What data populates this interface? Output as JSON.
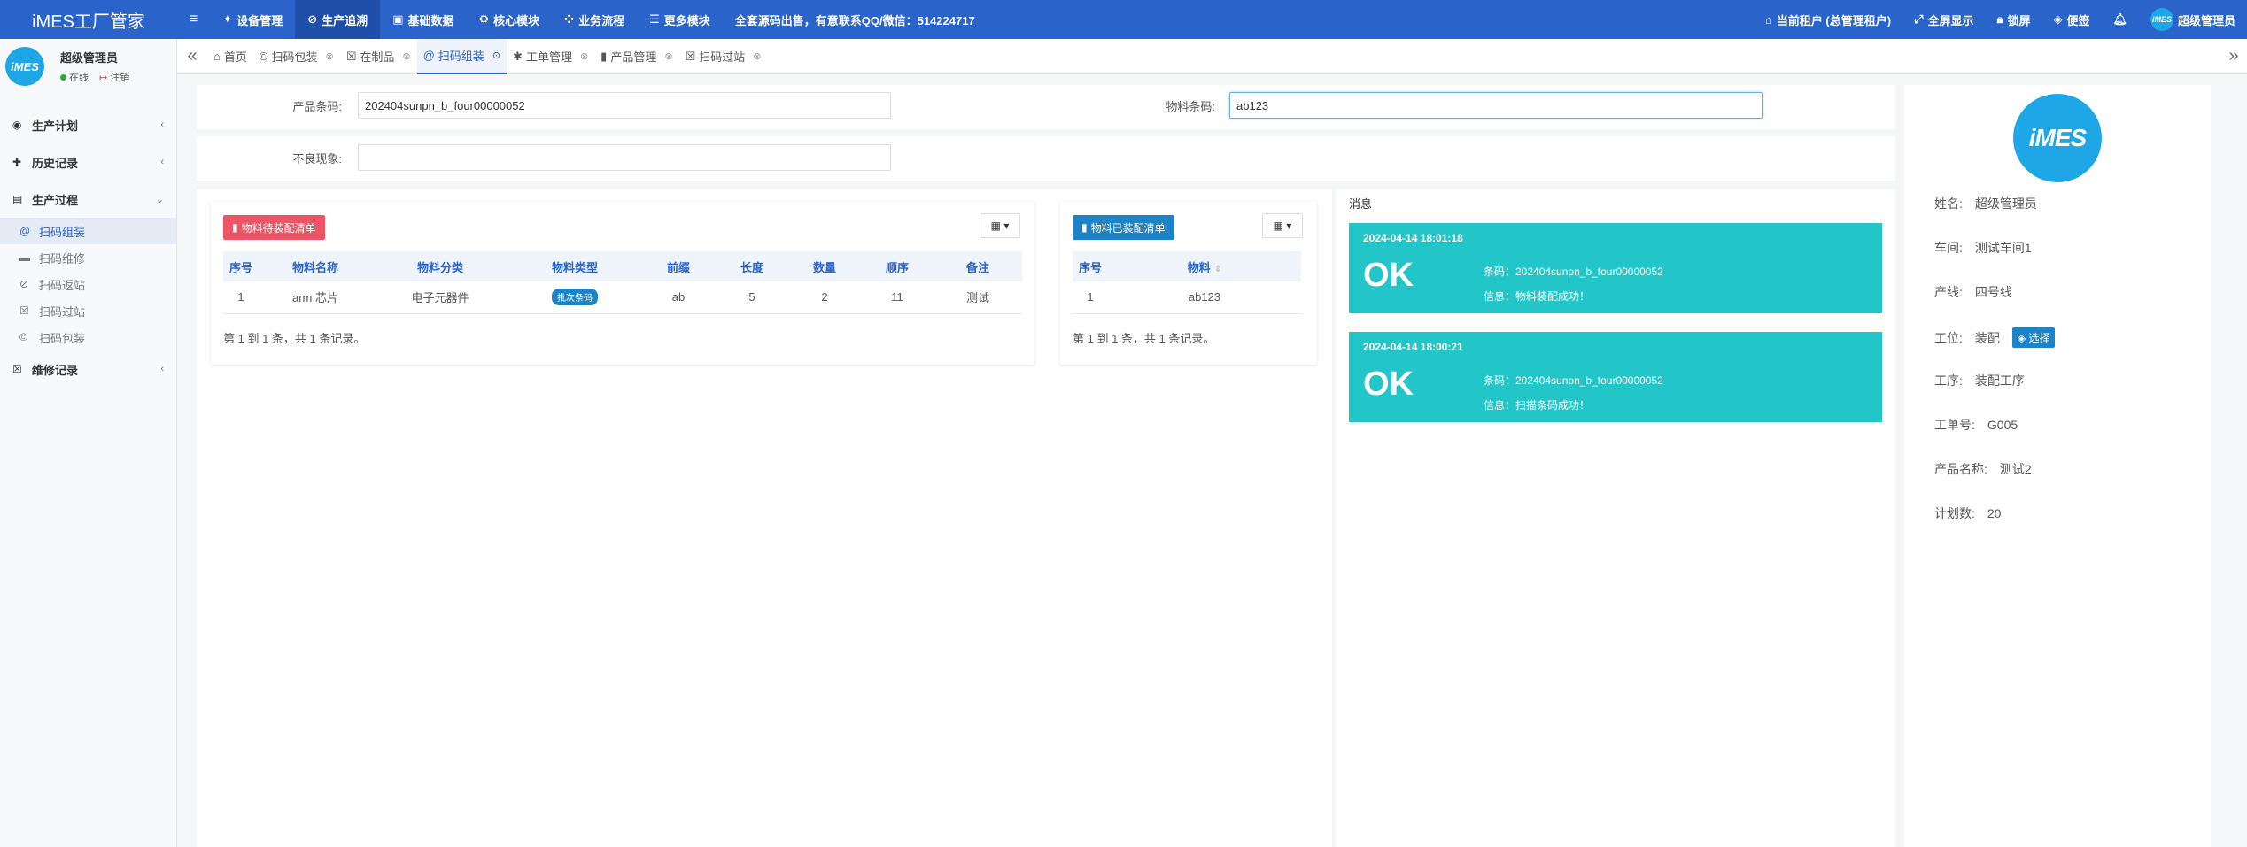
{
  "app": {
    "title": "iMES工厂管家"
  },
  "topnav": {
    "menu_icon": "≡",
    "items": [
      {
        "label": "设备管理",
        "icon": "tool-icon"
      },
      {
        "label": "生产追溯",
        "icon": "link-icon"
      },
      {
        "label": "基础数据",
        "icon": "book-icon"
      },
      {
        "label": "核心模块",
        "icon": "gear-icon"
      },
      {
        "label": "业务流程",
        "icon": "flow-icon"
      },
      {
        "label": "更多模块",
        "icon": "list-icon"
      }
    ],
    "notice": "全套源码出售，有意联系QQ/微信：514224717"
  },
  "topright": {
    "tenant": "当前租户 (总管理租户)",
    "fullscreen": "全屏显示",
    "lock": "锁屏",
    "note": "便签",
    "username": "超级管理员",
    "avatar_text": "iMES"
  },
  "sidebar": {
    "user_name": "超级管理员",
    "status_online": "在线",
    "status_logout": "注销",
    "avatar_text": "iMES",
    "menus": [
      {
        "label": "生产计划"
      },
      {
        "label": "历史记录"
      },
      {
        "label": "生产过程"
      }
    ],
    "sub_items": [
      {
        "label": "扫码组装"
      },
      {
        "label": "扫码维修"
      },
      {
        "label": "扫码返站"
      },
      {
        "label": "扫码过站"
      },
      {
        "label": "扫码包装"
      }
    ],
    "menu_after": {
      "label": "维修记录"
    }
  },
  "tabs": [
    {
      "label": "首页"
    },
    {
      "label": "扫码包装"
    },
    {
      "label": "在制品"
    },
    {
      "label": "扫码组装"
    },
    {
      "label": "工单管理"
    },
    {
      "label": "产品管理"
    },
    {
      "label": "扫码过站"
    }
  ],
  "form": {
    "product_code_label": "产品条码:",
    "product_code_value": "202404sunpn_b_four00000052",
    "material_code_label": "物料条码:",
    "material_code_value": "ab123",
    "defect_label": "不良现象:",
    "defect_value": ""
  },
  "pending_table": {
    "button_label": "物料待装配清单",
    "columns": [
      "序号",
      "物料名称",
      "物料分类",
      "物料类型",
      "前缀",
      "长度",
      "数量",
      "顺序",
      "备注"
    ],
    "rows": [
      [
        "1",
        "arm 芯片",
        "电子元器件",
        "批次条码",
        "ab",
        "5",
        "2",
        "11",
        "测试"
      ]
    ],
    "pageinfo": "第 1 到 1 条，共 1 条记录。"
  },
  "assembled_table": {
    "button_label": "物料已装配清单",
    "columns": [
      "序号",
      "物料"
    ],
    "rows": [
      [
        "1",
        "ab123"
      ]
    ],
    "pageinfo": "第 1 到 1 条，共 1 条记录。"
  },
  "messages": {
    "title": "消息",
    "items": [
      {
        "time": "2024-04-14 18:01:18",
        "status": "OK",
        "code_line": "条码：202404sunpn_b_four00000052",
        "info_line": "信息：物料装配成功！"
      },
      {
        "time": "2024-04-14 18:00:21",
        "status": "OK",
        "code_line": "条码：202404sunpn_b_four00000052",
        "info_line": "信息：扫描条码成功！"
      }
    ]
  },
  "info": {
    "logo_text": "iMES",
    "name_label": "姓名:",
    "name_value": "超级管理员",
    "workshop_label": "车间:",
    "workshop_value": "测试车间1",
    "line_label": "产线:",
    "line_value": "四号线",
    "station_label": "工位:",
    "station_value": "装配",
    "select_label": "选择",
    "process_label": "工序:",
    "process_value": "装配工序",
    "order_label": "工单号:",
    "order_value": "G005",
    "product_label": "产品名称:",
    "product_value": "测试2",
    "plan_label": "计划数:",
    "plan_value": "20"
  },
  "colors": {
    "header": "#2a63c9",
    "ok_box": "#23c6c8",
    "btn_red": "#ed5565",
    "btn_blue": "#1c84c6"
  }
}
